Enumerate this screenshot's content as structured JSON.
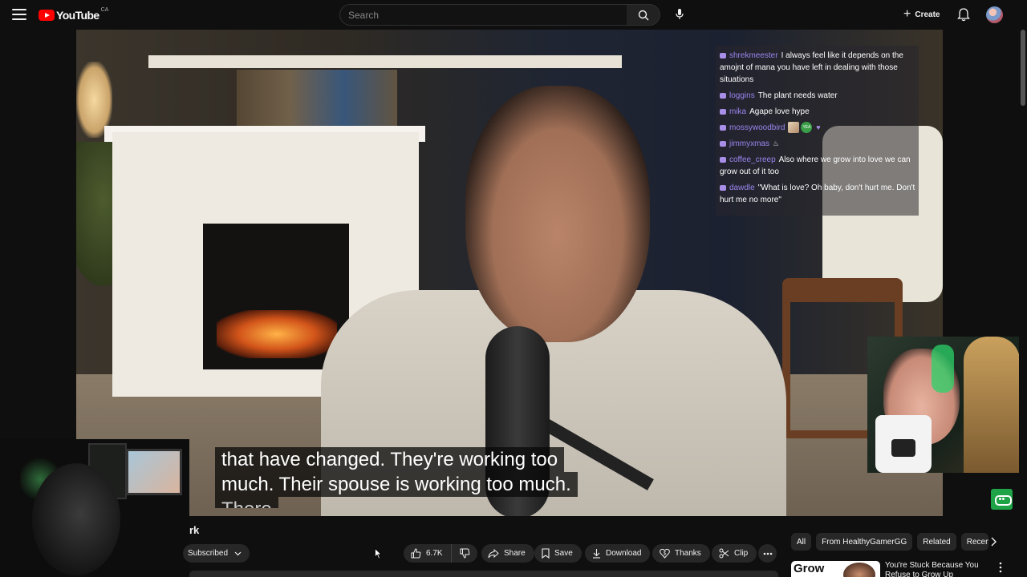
{
  "header": {
    "logo_text": "YouTube",
    "country_code": "CA",
    "search_placeholder": "Search",
    "create_label": "Create"
  },
  "chat": [
    {
      "user": "shrekmeester",
      "message": "I always feel like it depends on the amojnt of mana you have left in dealing with those situations"
    },
    {
      "user": "loggins",
      "message": "The plant needs water"
    },
    {
      "user": "mika",
      "message": "Agape love hype"
    },
    {
      "user": "mossywoodbird",
      "message": ""
    },
    {
      "user": "jimmyxmas",
      "message": ""
    },
    {
      "user": "coffee_creep",
      "message": "Also where we grow into love we can grow out of it too"
    },
    {
      "user": "dawdle",
      "message": "\"What is love? Oh baby, don't hurt me. Don't hurt me no more\""
    }
  ],
  "captions": {
    "line1": "that have changed. They're working too",
    "line2": "much. Their spouse is working too much.",
    "line3": "There"
  },
  "video": {
    "title_fragment": "rk",
    "subscribe_label": "Subscribed",
    "like_count": "6.7K",
    "share_label": "Share",
    "save_label": "Save",
    "download_label": "Download",
    "thanks_label": "Thanks",
    "clip_label": "Clip"
  },
  "related": {
    "chips": [
      "All",
      "From HealthyGamerGG",
      "Related",
      "Recently uploaded"
    ],
    "cards": [
      {
        "thumb_text": "Grow",
        "title": "You're Stuck Because You Refuse to Grow Up"
      }
    ]
  }
}
